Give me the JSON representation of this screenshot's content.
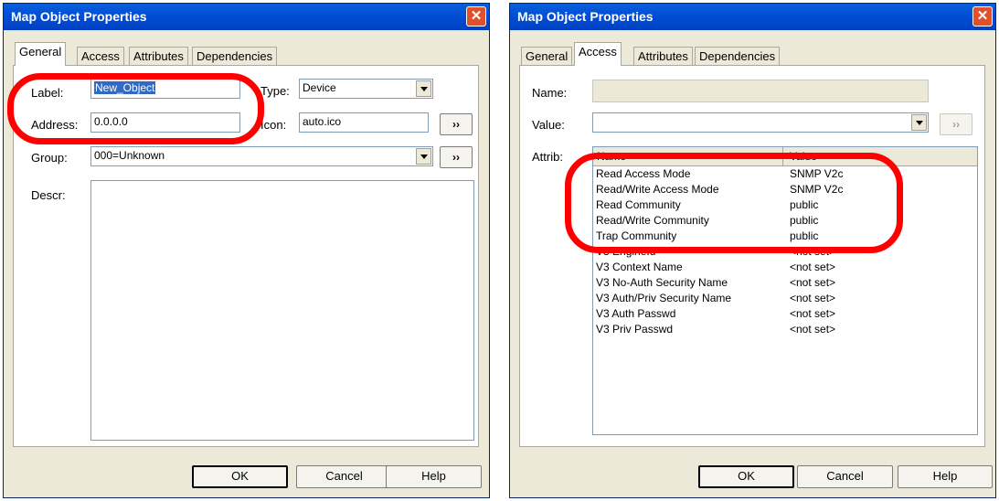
{
  "left_dialog": {
    "title": "Map Object Properties",
    "close_glyph": "✕",
    "tabs": [
      "General",
      "Access",
      "Attributes",
      "Dependencies"
    ],
    "active_tab": "General",
    "label_caption": "Label:",
    "label_value": "New_Object",
    "type_caption": "Type:",
    "type_value": "Device",
    "address_caption": "Address:",
    "address_value": "0.0.0.0",
    "icon_caption": "Icon:",
    "icon_value": "auto.ico",
    "group_caption": "Group:",
    "group_value": "000=Unknown",
    "descr_caption": "Descr:",
    "browse_label": "››",
    "buttons": {
      "ok": "OK",
      "cancel": "Cancel",
      "help": "Help"
    }
  },
  "right_dialog": {
    "title": "Map Object Properties",
    "close_glyph": "✕",
    "tabs": [
      "General",
      "Access",
      "Attributes",
      "Dependencies"
    ],
    "active_tab": "Access",
    "name_caption": "Name:",
    "name_value": "",
    "value_caption": "Value:",
    "value_value": "",
    "attrib_caption": "Attrib:",
    "browse_label": "››",
    "columns": [
      "Name",
      "Value"
    ],
    "rows": [
      {
        "name": "Read Access Mode",
        "value": "SNMP V2c"
      },
      {
        "name": "Read/Write Access Mode",
        "value": "SNMP V2c"
      },
      {
        "name": "Read Community",
        "value": "public"
      },
      {
        "name": "Read/Write Community",
        "value": "public"
      },
      {
        "name": "Trap Community",
        "value": "public"
      },
      {
        "name": "V3 EngineId",
        "value": "<not set>"
      },
      {
        "name": "V3 Context Name",
        "value": "<not set>"
      },
      {
        "name": "V3 No-Auth Security Name",
        "value": "<not set>"
      },
      {
        "name": "V3 Auth/Priv Security Name",
        "value": "<not set>"
      },
      {
        "name": "V3 Auth Passwd",
        "value": "<not set>"
      },
      {
        "name": "V3 Priv Passwd",
        "value": "<not set>"
      }
    ],
    "buttons": {
      "ok": "OK",
      "cancel": "Cancel",
      "help": "Help"
    }
  },
  "colors": {
    "titlebar": "#0050d8",
    "dialog_bg": "#ece9d8",
    "selection": "#316ac5",
    "annotation_ring": "#ff0000",
    "close_button": "#e0502a"
  }
}
